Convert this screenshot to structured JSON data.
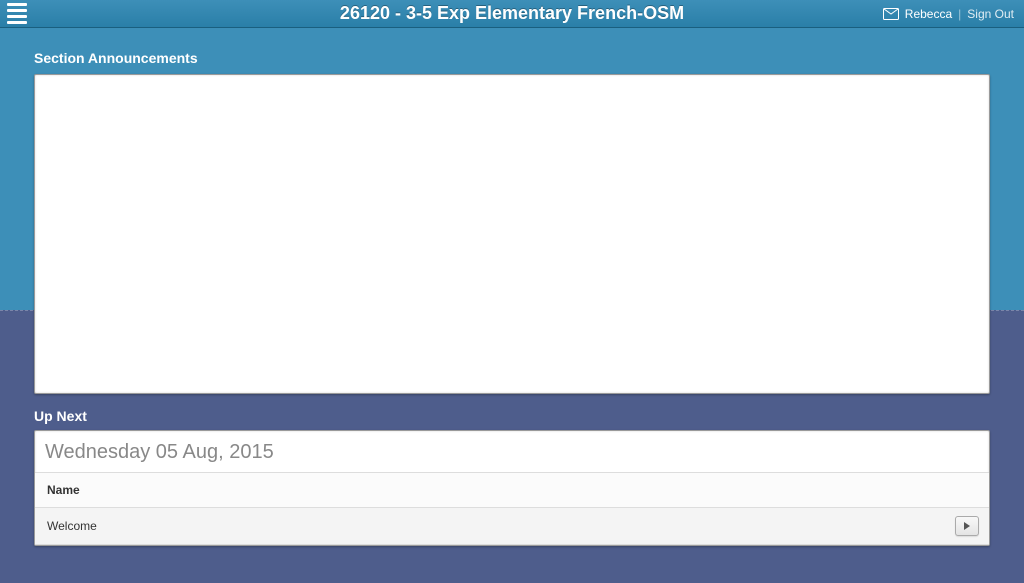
{
  "header": {
    "title": "26120 - 3-5 Exp Elementary French-OSM",
    "user": "Rebecca",
    "signout": "Sign Out"
  },
  "sections": {
    "announcements": {
      "label": "Section Announcements"
    },
    "upnext": {
      "label": "Up Next",
      "date": "Wednesday 05 Aug, 2015",
      "columns": {
        "name": "Name"
      },
      "items": [
        {
          "name": "Welcome"
        }
      ]
    }
  }
}
